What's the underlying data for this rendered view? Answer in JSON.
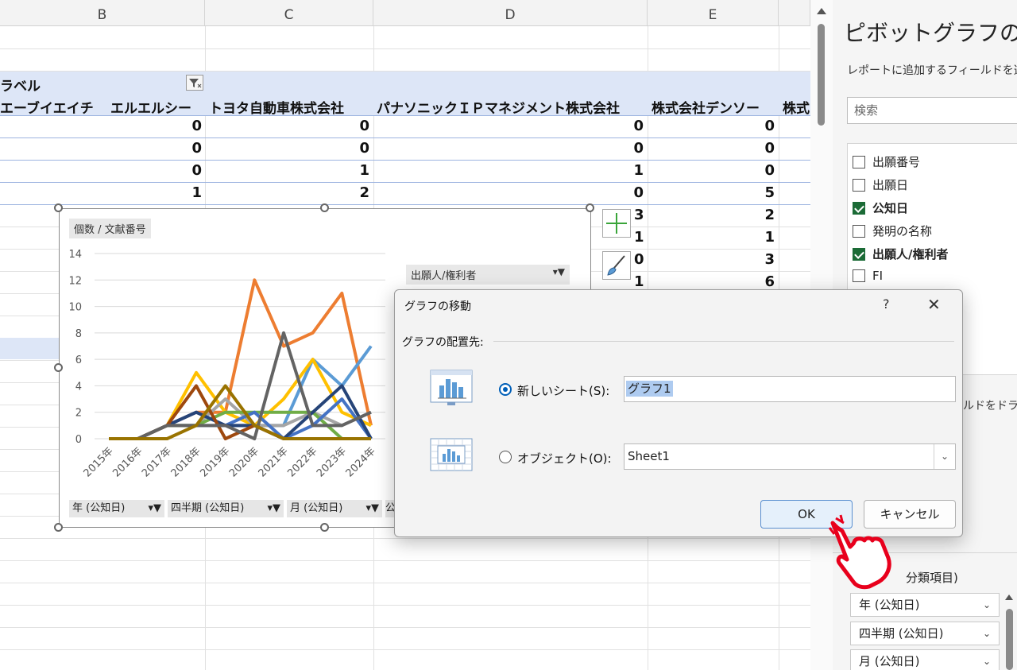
{
  "columns": [
    "B",
    "C",
    "D",
    "E"
  ],
  "pivot": {
    "label_header": "ラベル",
    "companies": [
      "エーブイエイチ",
      "エルエルシー",
      "トヨタ自動車株式会社",
      "パナソニックＩＰマネジメント株式会社",
      "株式会社デンソー",
      "株式"
    ],
    "rows": [
      [
        "0",
        "0",
        "0",
        "0"
      ],
      [
        "0",
        "0",
        "0",
        "0"
      ],
      [
        "0",
        "1",
        "1",
        "0"
      ],
      [
        "1",
        "2",
        "0",
        "5"
      ]
    ],
    "right_rows": [
      [
        "3",
        "2"
      ],
      [
        "1",
        "1"
      ],
      [
        "0",
        "3"
      ],
      [
        "1",
        "6"
      ]
    ]
  },
  "chart": {
    "value_chip": "個数 / 文献番号",
    "legend_chip": "出願人/権利者",
    "field_buttons": [
      "年 (公知日)",
      "四半期 (公知日)",
      "月 (公知日)",
      "公"
    ]
  },
  "chart_data": {
    "type": "line",
    "categories": [
      "2015年",
      "2016年",
      "2017年",
      "2018年",
      "2019年",
      "2020年",
      "2021年",
      "2022年",
      "2023年",
      "2024年"
    ],
    "ylim": [
      0,
      14
    ],
    "yticks": [
      "0",
      "2",
      "4",
      "6",
      "8",
      "10",
      "12",
      "14"
    ],
    "series": [
      {
        "color": "#ed7d31",
        "values": [
          0,
          0,
          1,
          2,
          2,
          12,
          7,
          8,
          11,
          1
        ]
      },
      {
        "color": "#5b9bd5",
        "values": [
          0,
          0,
          1,
          1,
          1,
          1,
          1,
          6,
          4,
          7
        ]
      },
      {
        "color": "#ffc000",
        "values": [
          0,
          0,
          1,
          5,
          2,
          1,
          3,
          6,
          2,
          1
        ]
      },
      {
        "color": "#a5a5a5",
        "values": [
          0,
          0,
          1,
          1,
          3,
          1,
          1,
          2,
          1,
          2
        ]
      },
      {
        "color": "#70ad47",
        "values": [
          0,
          0,
          1,
          1,
          2,
          2,
          2,
          2,
          0,
          0
        ]
      },
      {
        "color": "#4472c4",
        "values": [
          0,
          0,
          1,
          2,
          1,
          2,
          0,
          1,
          3,
          0
        ]
      },
      {
        "color": "#264478",
        "values": [
          0,
          0,
          1,
          2,
          1,
          1,
          0,
          2,
          4,
          0
        ]
      },
      {
        "color": "#9e480e",
        "values": [
          0,
          0,
          1,
          4,
          0,
          1,
          0,
          0,
          0,
          0
        ]
      },
      {
        "color": "#636363",
        "values": [
          0,
          0,
          1,
          1,
          1,
          0,
          8,
          1,
          1,
          2
        ]
      },
      {
        "color": "#997300",
        "values": [
          0,
          0,
          0,
          1,
          4,
          1,
          0,
          0,
          0,
          0
        ]
      }
    ]
  },
  "pane": {
    "title": "ピボットグラフのフィー",
    "subtitle": "レポートに追加するフィールドを選",
    "search_placeholder": "検索",
    "fields": [
      {
        "label": "出願番号",
        "checked": false
      },
      {
        "label": "出願日",
        "checked": false
      },
      {
        "label": "公知日",
        "checked": true
      },
      {
        "label": "発明の名称",
        "checked": false
      },
      {
        "label": "出願人/権利者",
        "checked": true
      },
      {
        "label": "FI",
        "checked": false
      }
    ],
    "drag_hint": "ルドをドラッ",
    "axis_header": "分類項目)",
    "axis_items": [
      "年 (公知日)",
      "四半期 (公知日)",
      "月 (公知日)"
    ]
  },
  "dialog": {
    "title": "グラフの移動",
    "help": "?",
    "close": "✕",
    "group_label": "グラフの配置先:",
    "option_new": "新しいシート(S):",
    "option_object": "オブジェクト(O):",
    "new_sheet_value": "グラフ1",
    "object_value": "Sheet1",
    "ok_label": "OK",
    "cancel_label": "キャンセル",
    "selected": "new"
  },
  "colors": {
    "accent": "#005fb8",
    "check_green": "#1b6b36",
    "pivot_band": "#dde6f7",
    "cursor_red": "#e8001c"
  }
}
